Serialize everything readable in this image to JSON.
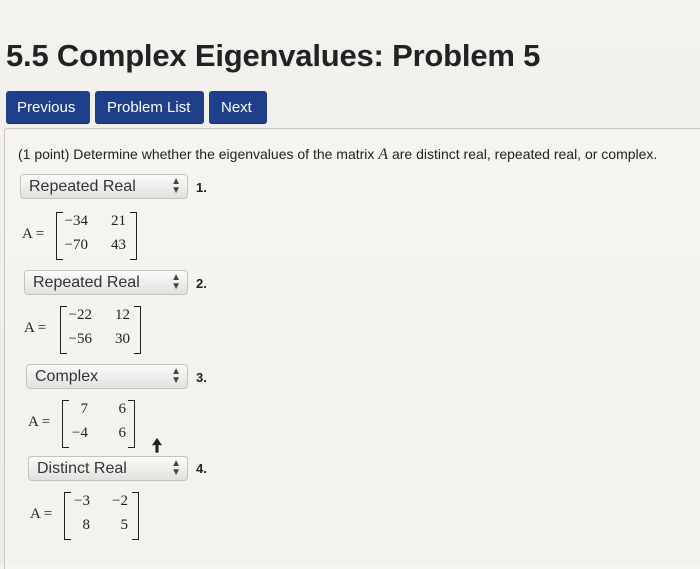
{
  "page": {
    "title": "5.5 Complex Eigenvalues: Problem 5"
  },
  "nav": {
    "previous": "Previous",
    "problem_list": "Problem List",
    "next": "Next"
  },
  "problem": {
    "prompt_prefix": "(1 point) Determine whether the eigenvalues of the matrix ",
    "prompt_var": "A",
    "prompt_suffix": " are distinct real, repeated real, or complex.",
    "parts": [
      {
        "selected": "Repeated Real",
        "number": "1.",
        "lhs": "A =",
        "matrix": [
          [
            "−34",
            "21"
          ],
          [
            "−70",
            "43"
          ]
        ]
      },
      {
        "selected": "Repeated Real",
        "number": "2.",
        "lhs": "A =",
        "matrix": [
          [
            "−22",
            "12"
          ],
          [
            "−56",
            "30"
          ]
        ]
      },
      {
        "selected": "Complex",
        "number": "3.",
        "lhs": "A =",
        "matrix": [
          [
            "7",
            "6"
          ],
          [
            "−4",
            "6"
          ]
        ]
      },
      {
        "selected": "Distinct Real",
        "number": "4.",
        "lhs": "A =",
        "matrix": [
          [
            "−3",
            "−2"
          ],
          [
            "8",
            "5"
          ]
        ]
      }
    ]
  },
  "icons": {
    "select_arrow": "up-down-chevron-icon",
    "cursor": "mouse-pointer-icon"
  }
}
